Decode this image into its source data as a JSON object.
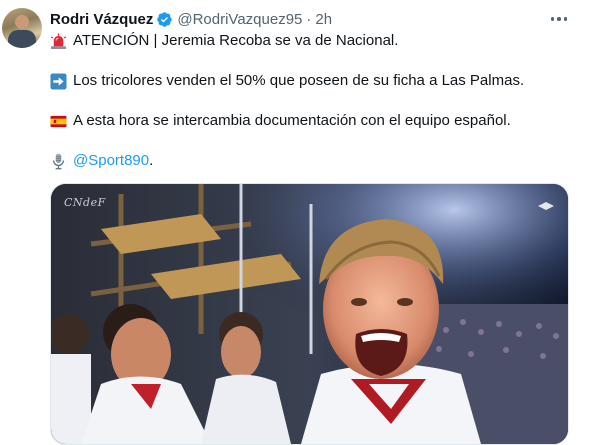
{
  "author": {
    "name": "Rodri Vázquez",
    "handle": "@RodriVazquez95",
    "separator": "·",
    "time": "2h",
    "verified": true
  },
  "tweet": {
    "lines": [
      {
        "icon": "rotating-light-icon",
        "text": "ATENCIÓN | Jeremia Recoba se va de Nacional."
      },
      {
        "icon": "arrow-right-icon",
        "text": "Los tricolores venden el 50% que poseen de su ficha a Las Palmas."
      },
      {
        "icon": "spain-flag-icon",
        "text": "A esta hora se intercambia documentación con el equipo español."
      },
      {
        "icon": "microphone-icon",
        "text": "@Sport890",
        "suffix": "."
      }
    ]
  },
  "media": {
    "watermark": "CNdeF"
  },
  "colors": {
    "link": "#1d9bf0",
    "verified": "#1d9bf0",
    "muted": "#536471",
    "text": "#0f1419"
  }
}
